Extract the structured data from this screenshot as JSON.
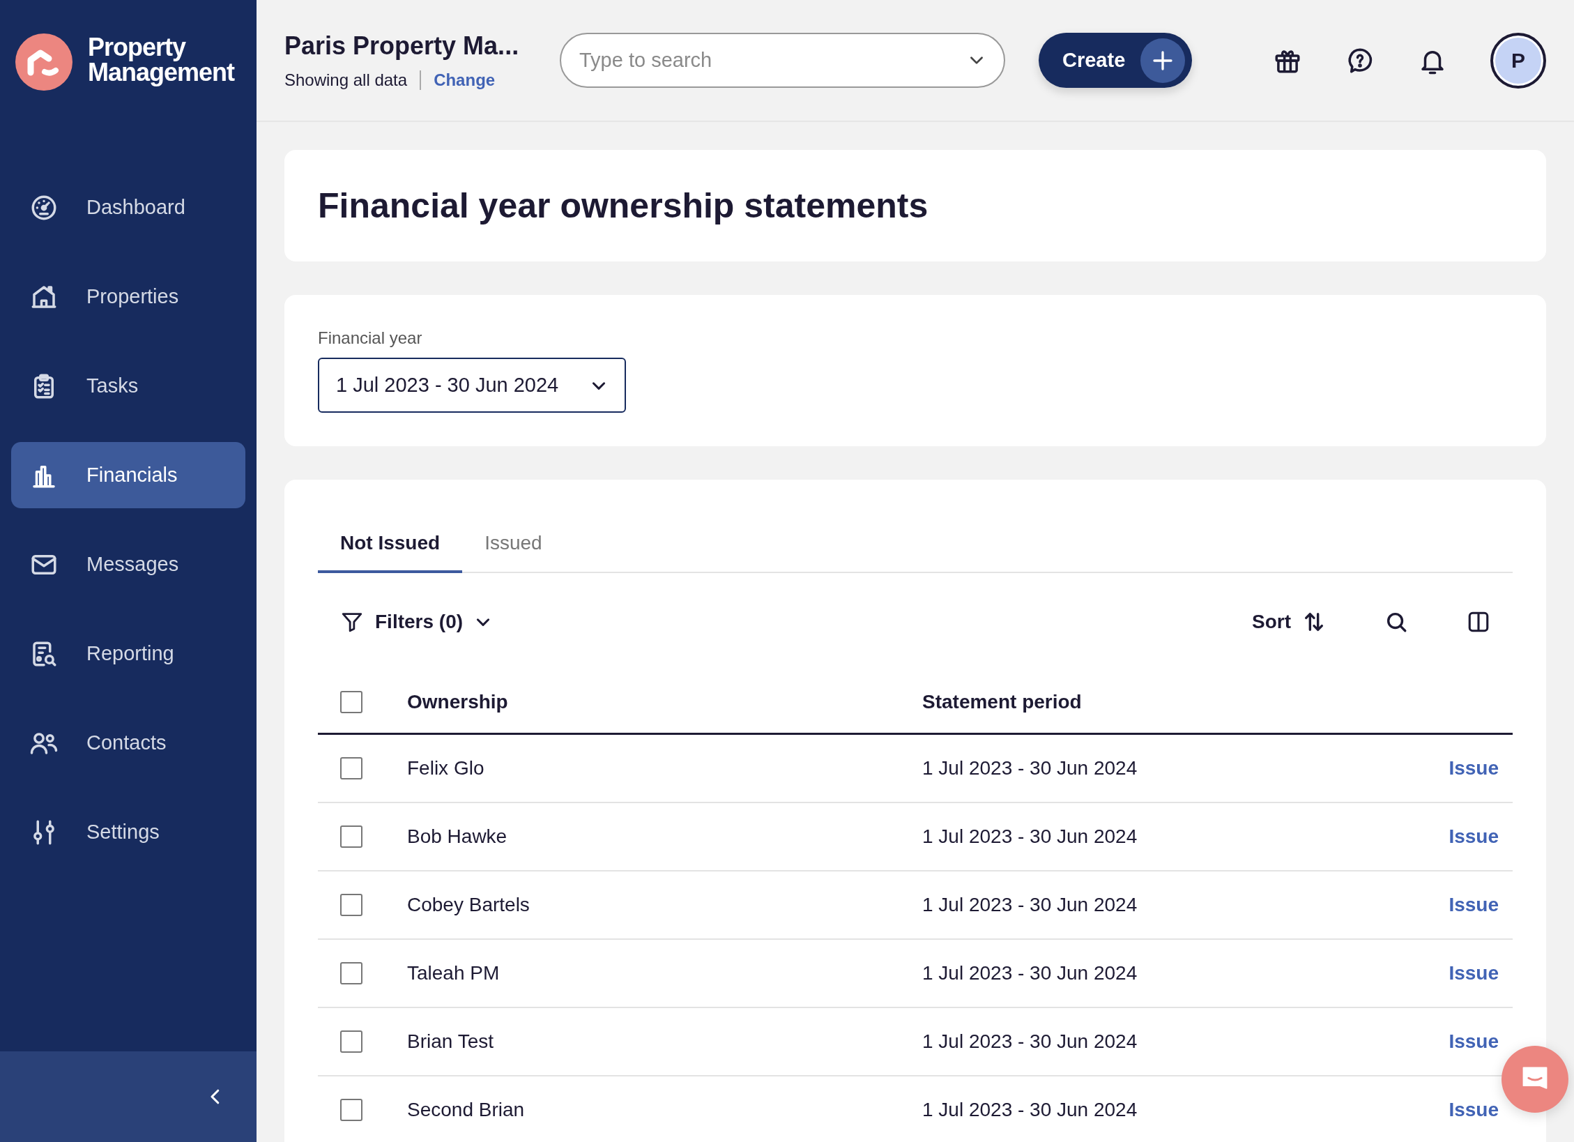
{
  "brand": {
    "name": "Property Management"
  },
  "sidebar": {
    "items": [
      {
        "label": "Dashboard",
        "kind": "dashboard",
        "selected": false
      },
      {
        "label": "Properties",
        "kind": "properties",
        "selected": false
      },
      {
        "label": "Tasks",
        "kind": "tasks",
        "selected": false
      },
      {
        "label": "Financials",
        "kind": "financials",
        "selected": true
      },
      {
        "label": "Messages",
        "kind": "messages",
        "selected": false
      },
      {
        "label": "Reporting",
        "kind": "reporting",
        "selected": false
      },
      {
        "label": "Contacts",
        "kind": "contacts",
        "selected": false
      },
      {
        "label": "Settings",
        "kind": "settings",
        "selected": false
      }
    ]
  },
  "header": {
    "account": "Paris Property Ma...",
    "data_scope": "Showing all data",
    "change_link": "Change",
    "search": {
      "placeholder": "Type to search"
    },
    "create_button": "Create",
    "avatar": "P"
  },
  "page": {
    "title": "Financial year ownership statements"
  },
  "financial_year": {
    "label": "Financial year",
    "value": "1 Jul 2023 - 30 Jun 2024"
  },
  "tabs": [
    {
      "label": "Not Issued",
      "selected": true
    },
    {
      "label": "Issued",
      "selected": false
    }
  ],
  "toolbar": {
    "filters": "Filters (0)",
    "sort": "Sort"
  },
  "table": {
    "columns": [
      "Ownership",
      "Statement period"
    ],
    "select_all_checked": false,
    "rows": [
      {
        "ownership": "Felix Glo",
        "period": "1 Jul 2023 - 30 Jun 2024",
        "action": "Issue",
        "checked": false
      },
      {
        "ownership": "Bob Hawke",
        "period": "1 Jul 2023 - 30 Jun 2024",
        "action": "Issue",
        "checked": false
      },
      {
        "ownership": "Cobey Bartels",
        "period": "1 Jul 2023 - 30 Jun 2024",
        "action": "Issue",
        "checked": false
      },
      {
        "ownership": "Taleah PM",
        "period": "1 Jul 2023 - 30 Jun 2024",
        "action": "Issue",
        "checked": false
      },
      {
        "ownership": "Brian Test",
        "period": "1 Jul 2023 - 30 Jun 2024",
        "action": "Issue",
        "checked": false
      },
      {
        "ownership": "Second Brian",
        "period": "1 Jul 2023 - 30 Jun 2024",
        "action": "Issue",
        "checked": false
      }
    ]
  }
}
